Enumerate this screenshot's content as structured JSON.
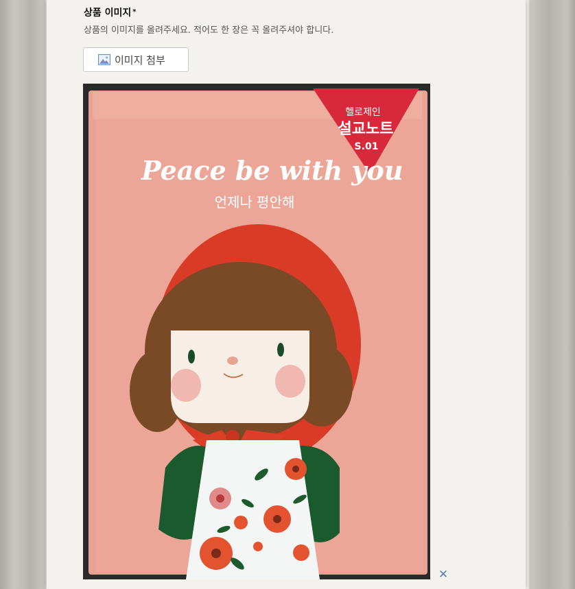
{
  "section": {
    "title": "상품 이미지",
    "required_mark": "*",
    "helper_text": "상품의 이미지를 올려주세요. 적어도 한 장은 꼭 올려주셔야 합니다."
  },
  "attach_button": {
    "label": "이미지 첨부",
    "icon": "image-icon"
  },
  "preview": {
    "image_text": {
      "badge_line1": "헬로제인",
      "badge_line2": "설교노트",
      "badge_line3": "S.01",
      "cover_title": "Peace be with you",
      "cover_subtitle": "언제나 평안해"
    },
    "remove_label": "✕"
  },
  "colors": {
    "remove_accent": "#5b7fa8",
    "cover_pink": "#e9a596",
    "badge_red": "#d7283b"
  }
}
